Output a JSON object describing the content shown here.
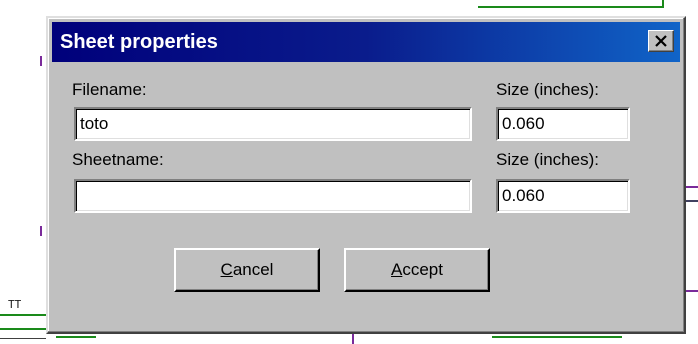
{
  "dialog": {
    "title": "Sheet properties",
    "close_glyph": "✕"
  },
  "form": {
    "filename_label": "Filename:",
    "filename_value": "toto",
    "filename_size_label": "Size (inches):",
    "filename_size_value": "0.060",
    "sheetname_label": "Sheetname:",
    "sheetname_value": "",
    "sheetname_size_label": "Size (inches):",
    "sheetname_size_value": "0.060"
  },
  "buttons": {
    "cancel_mnemonic": "C",
    "cancel_rest": "ancel",
    "accept_mnemonic": "A",
    "accept_rest": "ccept"
  },
  "background": {
    "fragment_1": "TT"
  },
  "colors": {
    "title_gradient_start": "#00007b",
    "title_gradient_end": "#1064c8",
    "dialog_face": "#c0c0c0",
    "schematic_wire": "#1a8a1a",
    "schematic_pin": "#7a2a9a"
  }
}
